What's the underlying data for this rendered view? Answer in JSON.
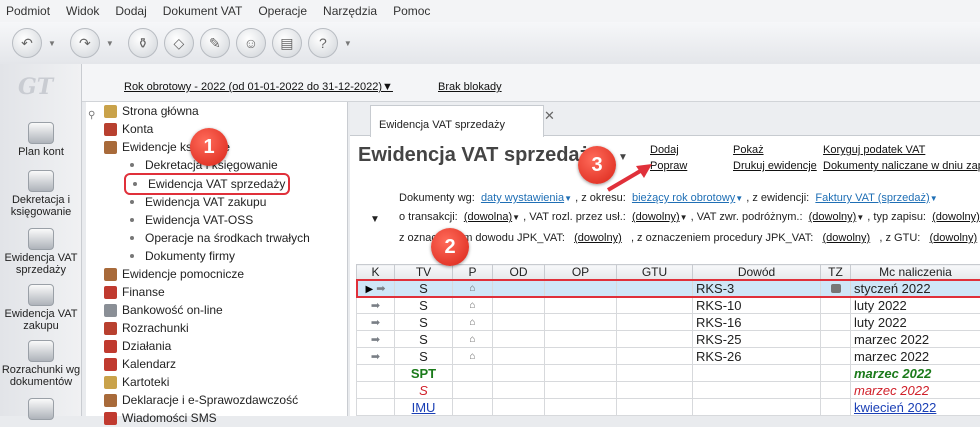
{
  "menu": [
    "Podmiot",
    "Widok",
    "Dodaj",
    "Dokument VAT",
    "Operacje",
    "Narzędzia",
    "Pomoc"
  ],
  "logo": "GT",
  "leftbar": [
    {
      "label": "Plan kont"
    },
    {
      "label": "Dekretacja i księgowanie"
    },
    {
      "label": "Ewidencja VAT sprzedaży"
    },
    {
      "label": "Ewidencja VAT zakupu"
    },
    {
      "label": "Rozrachunki wg dokumentów"
    }
  ],
  "topstrip": {
    "rok": "Rok obrotowy - 2022  (od 01-01-2022 do 31-12-2022)▼",
    "blokady": "Brak blokady"
  },
  "tree": [
    {
      "label": "Strona główna",
      "level": 0
    },
    {
      "label": "Konta",
      "level": 0
    },
    {
      "label": "Ewidencje księgowe",
      "level": 0
    },
    {
      "label": "Dekretacja i księgowanie",
      "level": 1
    },
    {
      "label": "Ewidencja VAT sprzedaży",
      "level": 1,
      "selected": true
    },
    {
      "label": "Ewidencja VAT zakupu",
      "level": 1
    },
    {
      "label": "Ewidencja VAT-OSS",
      "level": 1
    },
    {
      "label": "Operacje na środkach trwałych",
      "level": 1
    },
    {
      "label": "Dokumenty firmy",
      "level": 1
    },
    {
      "label": "Ewidencje pomocnicze",
      "level": 0
    },
    {
      "label": "Finanse",
      "level": 0
    },
    {
      "label": "Bankowość on-line",
      "level": 0
    },
    {
      "label": "Rozrachunki",
      "level": 0
    },
    {
      "label": "Działania",
      "level": 0
    },
    {
      "label": "Kalendarz",
      "level": 0
    },
    {
      "label": "Kartoteki",
      "level": 0
    },
    {
      "label": "Deklaracje i e-Sprawozdawczość",
      "level": 0
    },
    {
      "label": "Wiadomości SMS",
      "level": 0
    }
  ],
  "tab": {
    "label": "Ewidencja VAT sprzedaży",
    "close": "✕"
  },
  "page_title": "Ewidencja VAT sprzedaży",
  "actions": {
    "dodaj": "Dodaj",
    "popraw": "Popraw",
    "pokaz": "Pokaż",
    "drukuj": "Drukuj ewidencje",
    "koryguj": "Koryguj podatek VAT",
    "naliczane": "Dokumenty naliczane w dniu zapis"
  },
  "filters": {
    "dok_wg": "Dokumenty wg:",
    "daty": "daty wystawienia",
    "z_okresu": ", z okresu:",
    "okres": "bieżący rok obrotowy",
    "z_ewid": ", z ewidencji:",
    "ewid": "Faktury VAT (sprzedaż)",
    "o_trans": "o transakcji:",
    "dowolna": "(dowolna)",
    "vat_rozl": ", VAT rozl. przez usł.:",
    "dowolny": "(dowolny)",
    "vat_zwr": ", VAT zwr. podróżnym.:",
    "typ_zap": ", typ zapisu:",
    "z_ozn_dow": "z oznaczeniem dowodu JPK_VAT:",
    "z_ozn_proc": ", z oznaczeniem procedury JPK_VAT:",
    "z_gtu": ", z GTU:"
  },
  "table": {
    "headers": [
      "K",
      "TV",
      "P",
      "OD",
      "OP",
      "GTU",
      "Dowód",
      "TZ",
      "Mc naliczenia"
    ],
    "rows": [
      {
        "tv": "S",
        "dowod": "RKS-3",
        "mc": "styczeń 2022",
        "sel": true
      },
      {
        "tv": "S",
        "dowod": "RKS-10",
        "mc": "luty 2022"
      },
      {
        "tv": "S",
        "dowod": "RKS-16",
        "mc": "luty 2022"
      },
      {
        "tv": "S",
        "dowod": "RKS-25",
        "mc": "marzec 2022"
      },
      {
        "tv": "S",
        "dowod": "RKS-26",
        "mc": "marzec 2022"
      },
      {
        "tv": "SPT",
        "mc": "marzec 2022"
      },
      {
        "tv": "S",
        "mc": "marzec 2022"
      },
      {
        "tv": "IMU",
        "mc": "kwiecień 2022"
      }
    ]
  },
  "badges": [
    "1",
    "2",
    "3"
  ],
  "colors": {
    "accent_red": "#e0303a",
    "link_blue": "#1f6fb5",
    "row_select": "#cfe6f7",
    "green": "#1a7a1a"
  }
}
